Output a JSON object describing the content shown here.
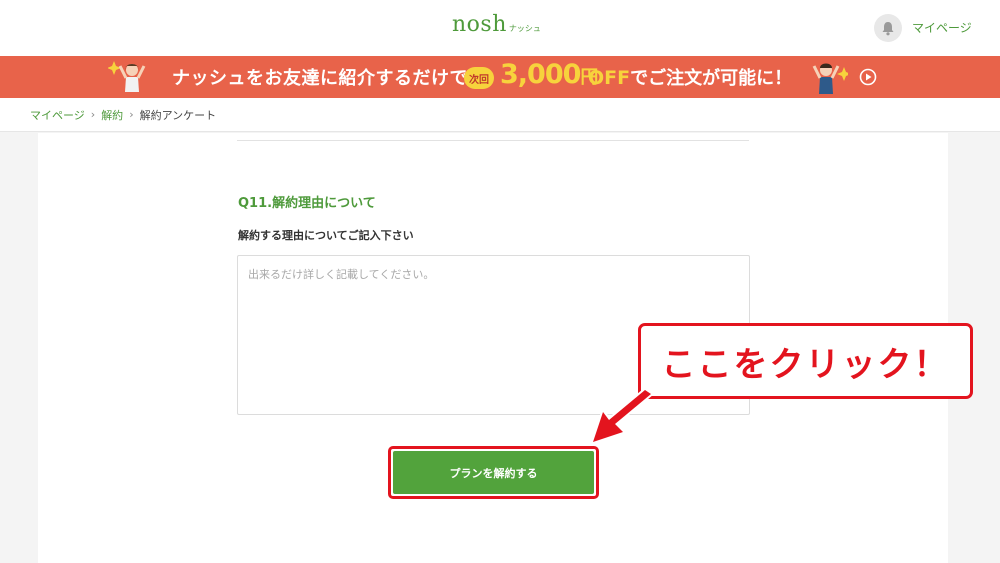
{
  "header": {
    "logo_main": "nosh",
    "logo_sub": "ナッシュ",
    "notification_icon": "bell-icon",
    "mypage_label": "マイページ"
  },
  "banner": {
    "text": "ナッシュをお友達に紹介するだけで",
    "badge": "次回",
    "amount": "3,000",
    "yen": "円",
    "off": "OFF",
    "suffix": "でご注文が可能に！",
    "play_icon": "play-icon",
    "background_color": "#e8634a",
    "accent_color": "#f7d33c"
  },
  "breadcrumb": {
    "items": [
      "マイページ",
      "解約"
    ],
    "current": "解約アンケート"
  },
  "survey": {
    "question_title": "Q11.解約理由について",
    "question_label": "解約する理由についてご記入下さい",
    "textarea_value": "",
    "textarea_placeholder": "出来るだけ詳しく記載してください。"
  },
  "submit_button": {
    "label": "プランを解約する",
    "color": "#52a33c"
  },
  "annotation": {
    "callout_text": "ここをクリック！",
    "color": "#e3141e"
  }
}
